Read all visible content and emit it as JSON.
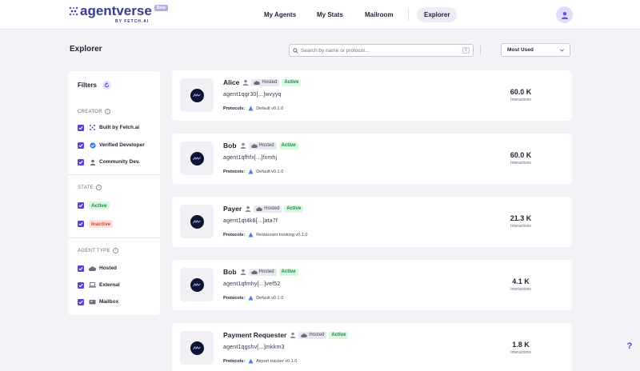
{
  "header": {
    "brand": "agentverse",
    "beta_label": "Beta",
    "byline": "BY FETCH.AI",
    "nav": [
      {
        "label": "My Agents",
        "active": false
      },
      {
        "label": "My Stats",
        "active": false
      },
      {
        "label": "Mailroom",
        "active": false
      },
      {
        "label": "Explorer",
        "active": true
      }
    ],
    "avatar_icon": "user-icon"
  },
  "page": {
    "title": "Explorer",
    "search_placeholder": "Search by name or protocol...",
    "search_shortcut": "/",
    "sort_selected": "Most Used"
  },
  "filters": {
    "title": "Filters",
    "creator": {
      "label": "CREATOR",
      "options": [
        {
          "label": "Built by Fetch.ai",
          "icon": "fetch-logo-icon",
          "checked": true
        },
        {
          "label": "Verified Developer",
          "icon": "verified-badge-icon",
          "checked": true
        },
        {
          "label": "Community Dev.",
          "icon": "person-icon",
          "checked": true
        }
      ]
    },
    "state": {
      "label": "STATE",
      "options": [
        {
          "label": "Active",
          "checked": true
        },
        {
          "label": "Inactive",
          "checked": true
        }
      ]
    },
    "agent_type": {
      "label": "AGENT TYPE",
      "options": [
        {
          "label": "Hosted",
          "icon": "cloud-icon",
          "checked": true
        },
        {
          "label": "External",
          "icon": "laptop-icon",
          "checked": true
        },
        {
          "label": "Mailbox",
          "icon": "mailbox-icon",
          "checked": true
        }
      ]
    }
  },
  "agents": [
    {
      "name": "Alice",
      "type": "Hosted",
      "status": "Active",
      "address": "agent1qgr30[...]wvyyq",
      "protocols_label": "Protocols:",
      "protocol": "Default v0.1.0",
      "interactions": "60.0 K",
      "interactions_label": "Interactions"
    },
    {
      "name": "Bob",
      "type": "Hosted",
      "status": "Active",
      "address": "agent1qfhfx[...]fxmhj",
      "protocols_label": "Protocols:",
      "protocol": "Default v0.1.0",
      "interactions": "60.0 K",
      "interactions_label": "Interactions"
    },
    {
      "name": "Payer",
      "type": "Hosted",
      "status": "Active",
      "address": "agent1qt4k6[...]ata7f",
      "protocols_label": "Protocols:",
      "protocol": "Restaurant booking v0.1.0",
      "interactions": "21.3 K",
      "interactions_label": "Interactions"
    },
    {
      "name": "Bob",
      "type": "Hosted",
      "status": "Active",
      "address": "agent1qfmhy[...]vef52",
      "protocols_label": "Protocols:",
      "protocol": "Default v0.1.0",
      "interactions": "4.1 K",
      "interactions_label": "Interactions"
    },
    {
      "name": "Payment Requester",
      "type": "Hosted",
      "status": "Active",
      "address": "agent1qgshv[...]mkkm3",
      "protocols_label": "Protocols:",
      "protocol": "Airport tracker v0.1.0",
      "interactions": "1.8 K",
      "interactions_label": "Interactions"
    }
  ],
  "help_label": "?",
  "colors": {
    "accent": "#5b3fd6",
    "active_bg": "#d9f7e2",
    "active_text": "#1c8a45",
    "inactive_bg": "#fde0da",
    "inactive_text": "#d2462c"
  }
}
